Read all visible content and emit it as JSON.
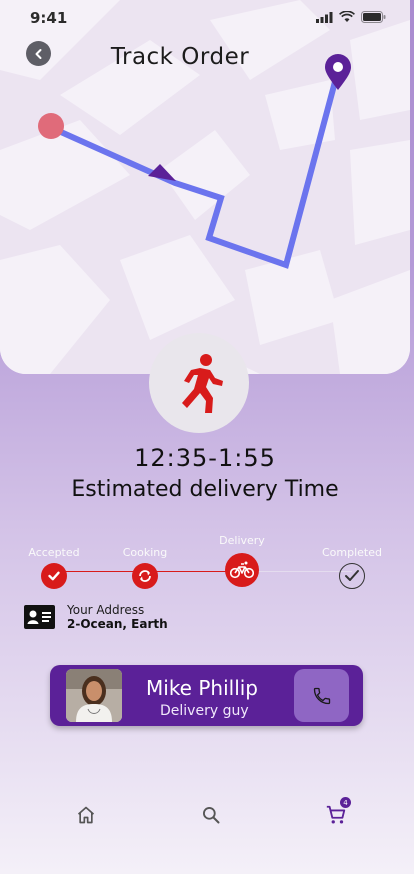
{
  "status_bar": {
    "time": "9:41",
    "icons": [
      "signal-icon",
      "wifi-icon",
      "battery-icon"
    ]
  },
  "header": {
    "title": "Track Order",
    "back_icon": "chevron-left-icon"
  },
  "map": {
    "route_color": "#6b74ee",
    "pin_color": "#5b2198",
    "origin_color": "#e06b7a"
  },
  "delivery": {
    "time_range": "12:35-1:55",
    "label": "Estimated delivery Time",
    "runner_icon": "running-man-icon"
  },
  "tracker": {
    "steps": [
      {
        "label": "Accepted",
        "icon": "check-icon",
        "state": "done"
      },
      {
        "label": "Cooking",
        "icon": "refresh-icon",
        "state": "done"
      },
      {
        "label": "Delivery",
        "icon": "bicycle-icon",
        "state": "current"
      },
      {
        "label": "Completed",
        "icon": "check-circle-icon",
        "state": "pending"
      }
    ],
    "active_color": "#d81b1b"
  },
  "address": {
    "title": "Your Address",
    "value": "2-Ocean, Earth",
    "icon": "id-card-icon"
  },
  "driver": {
    "name": "Mike Phillip",
    "role": "Delivery guy",
    "call_icon": "phone-icon"
  },
  "bottom_nav": {
    "items": [
      "home-icon",
      "search-icon",
      "cart-icon"
    ],
    "cart_badge": "4"
  },
  "colors": {
    "accent": "#5b2198",
    "danger": "#d81b1b"
  }
}
